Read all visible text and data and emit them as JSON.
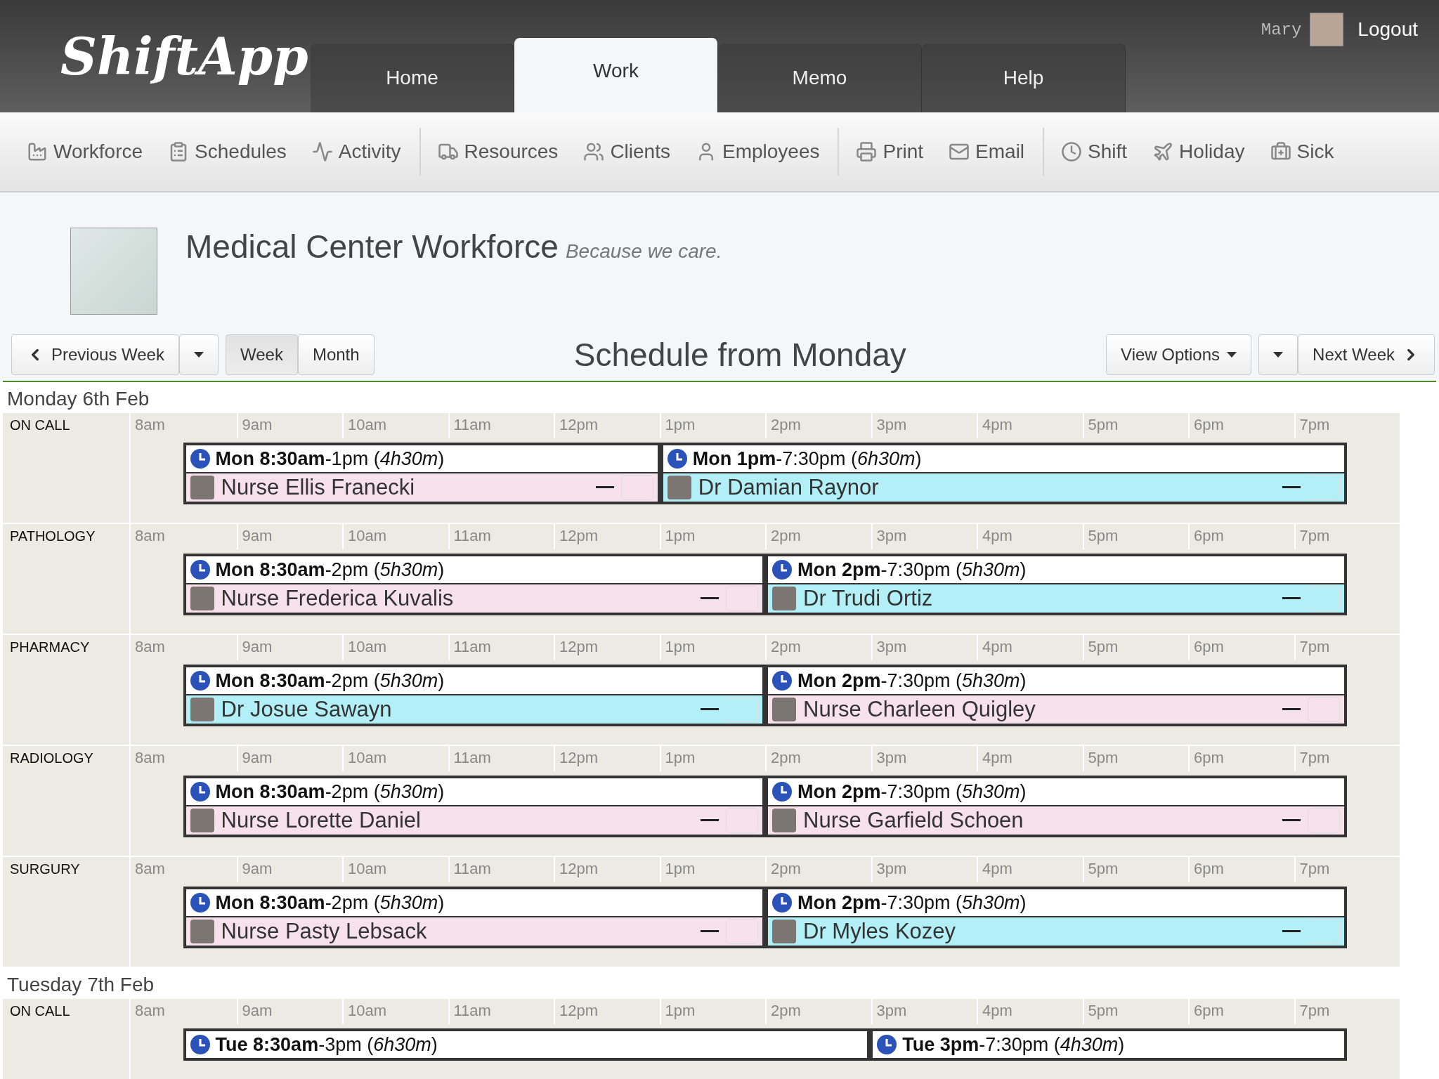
{
  "header": {
    "logo": "ShiftApp",
    "tabs": [
      {
        "label": "Home",
        "selected": false
      },
      {
        "label": "Work",
        "selected": true
      },
      {
        "label": "Memo",
        "selected": false
      },
      {
        "label": "Help",
        "selected": false
      }
    ],
    "user": "Mary",
    "logout": "Logout"
  },
  "toolbar": {
    "groups": [
      [
        {
          "label": "Workforce"
        },
        {
          "label": "Schedules"
        },
        {
          "label": "Activity"
        }
      ],
      [
        {
          "label": "Resources"
        },
        {
          "label": "Clients"
        },
        {
          "label": "Employees"
        }
      ],
      [
        {
          "label": "Print"
        },
        {
          "label": "Email"
        }
      ],
      [
        {
          "label": "Shift"
        },
        {
          "label": "Holiday"
        },
        {
          "label": "Sick"
        }
      ]
    ]
  },
  "page": {
    "title": "Medical Center Workforce",
    "tagline": "Because we care."
  },
  "controls": {
    "previous": "Previous Week",
    "views": [
      {
        "label": "Week",
        "selected": true
      },
      {
        "label": "Month",
        "selected": false
      }
    ],
    "heading": "Schedule from Monday",
    "view_options": "View Options",
    "next": "Next Week"
  },
  "days": [
    {
      "label": "Monday 6th Feb",
      "rows": [
        {
          "label": "ON CALL",
          "hours": [
            "8am",
            "9am",
            "10am",
            "11am",
            "12pm",
            "1pm",
            "2pm",
            "3pm",
            "4pm",
            "5pm",
            "6pm",
            "7pm"
          ],
          "shifts": [
            {
              "time": "**Mon 8:30am**-1pm (*4h30m*)",
              "staff": {
                "name": "Nurse Ellis Franecki",
                "color": "#f7e1ea",
                "checked": false
              }
            },
            {
              "time": "**Mon 1pm**-7:30pm (*6h30m*)",
              "staff": {
                "name": "Dr Damian Raynor",
                "color": "#b3eff7",
                "checked": false
              }
            }
          ]
        },
        {
          "label": "PATHOLOGY",
          "hours": [
            "8am",
            "9am",
            "10am",
            "11am",
            "12pm",
            "1pm",
            "2pm",
            "3pm",
            "4pm",
            "5pm",
            "6pm",
            "7pm"
          ],
          "shifts": [
            {
              "time": "**Mon 8:30am**-2pm (*5h30m*)",
              "staff": {
                "name": "Nurse Frederica Kuvalis",
                "color": "#f7e1ea",
                "checked": false
              }
            },
            {
              "time": "**Mon 2pm**-7:30pm (*5h30m*)",
              "staff": {
                "name": "Dr Trudi Ortiz",
                "color": "#b3eff7",
                "checked": false
              }
            }
          ]
        },
        {
          "label": "PHARMACY",
          "hours": [
            "8am",
            "9am",
            "10am",
            "11am",
            "12pm",
            "1pm",
            "2pm",
            "3pm",
            "4pm",
            "5pm",
            "6pm",
            "7pm"
          ],
          "shifts": [
            {
              "time": "**Mon 8:30am**-2pm (*5h30m*)",
              "staff": {
                "name": "Dr Josue Sawayn",
                "color": "#b3eff7",
                "checked": false
              }
            },
            {
              "time": "**Mon 2pm**-7:30pm (*5h30m*)",
              "staff": {
                "name": "Nurse Charleen Quigley",
                "color": "#f7e1ea",
                "checked": false
              }
            }
          ]
        },
        {
          "label": "RADIOLOGY",
          "hours": [
            "8am",
            "9am",
            "10am",
            "11am",
            "12pm",
            "1pm",
            "2pm",
            "3pm",
            "4pm",
            "5pm",
            "6pm",
            "7pm"
          ],
          "shifts": [
            {
              "time": "**Mon 8:30am**-2pm (*5h30m*)",
              "staff": {
                "name": "Nurse Lorette Daniel",
                "color": "#f7e1ea",
                "checked": false
              }
            },
            {
              "time": "**Mon 2pm**-7:30pm (*5h30m*)",
              "staff": {
                "name": "Nurse Garfield Schoen",
                "color": "#f7e1ea",
                "checked": false
              }
            }
          ]
        },
        {
          "label": "SURGURY",
          "hours": [
            "8am",
            "9am",
            "10am",
            "11am",
            "12pm",
            "1pm",
            "2pm",
            "3pm",
            "4pm",
            "5pm",
            "6pm",
            "7pm"
          ],
          "shifts": [
            {
              "time": "**Mon 8:30am**-2pm (*5h30m*)",
              "staff": {
                "name": "Nurse Pasty Lebsack",
                "color": "#f7e1ea",
                "checked": false
              }
            },
            {
              "time": "**Mon 2pm**-7:30pm (*5h30m*)",
              "staff": {
                "name": "Dr Myles Kozey",
                "color": "#b3eff7",
                "checked": false
              }
            }
          ]
        }
      ]
    },
    {
      "label": "Tuesday 7th Feb",
      "rows": [
        {
          "label": "ON CALL",
          "hours": [
            "8am",
            "9am",
            "10am",
            "11am",
            "12pm",
            "1pm",
            "2pm",
            "3pm",
            "4pm",
            "5pm",
            "6pm",
            "7pm"
          ],
          "shifts": [
            {
              "time": "**Tue 8:30am**-3pm (*6h30m*)"
            },
            {
              "time": "**Tue 3pm**-7:30pm (*4h30m*)"
            }
          ]
        }
      ]
    }
  ]
}
